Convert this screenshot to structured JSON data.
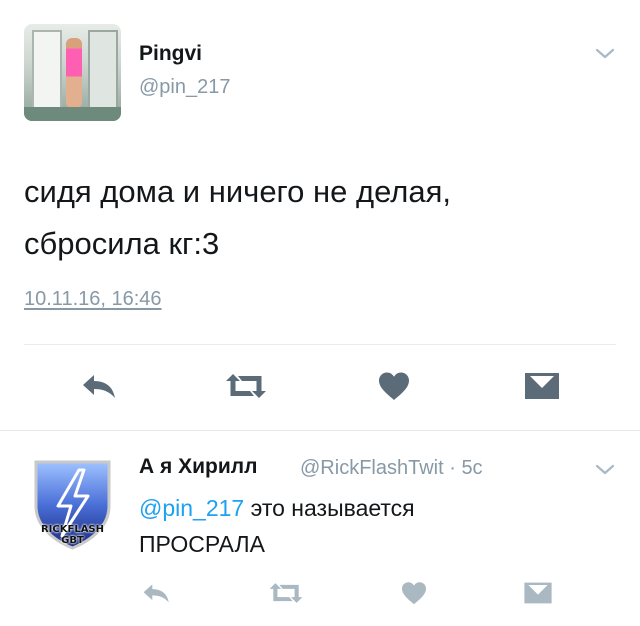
{
  "tweet": {
    "author_name": "Pingvi",
    "author_handle": "@pin_217",
    "text_line1": "сидя дома и ничего не делая,",
    "text_line2": "сбросила кг:3",
    "timestamp": "10.11.16, 16:46",
    "avatar_icon": "user-photo"
  },
  "reply": {
    "author_name": "А я Хирилл",
    "author_handle": "@RickFlashTwit",
    "separator": " · ",
    "time_ago": "5с",
    "mention": "@pin_217",
    "text_after_mention": " это называется",
    "text_line2": "ПРОСРАЛА",
    "avatar_badge_line1": "RICKFLASH",
    "avatar_badge_line2": "GBT",
    "avatar_icon": "lightning-shield-logo"
  },
  "colors": {
    "icon_dark": "#5b6b78",
    "icon_light": "#aab8c2",
    "muted_text": "#8899a6",
    "link": "#1da1f2",
    "divider": "#e6ecf0"
  },
  "icons": {
    "reply": "reply-icon",
    "retweet": "retweet-icon",
    "like": "heart-icon",
    "dm": "envelope-icon",
    "menu": "chevron-down-icon"
  }
}
